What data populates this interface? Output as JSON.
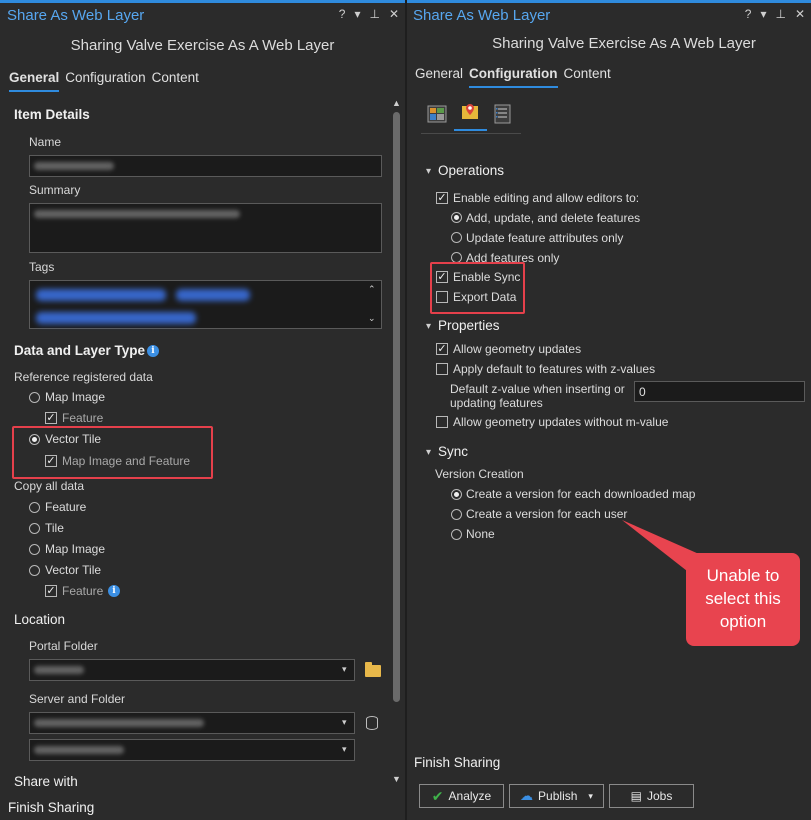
{
  "left": {
    "title": "Share As Web Layer",
    "window_controls": [
      "?",
      "▾",
      "⊥",
      "✕"
    ],
    "subtitle": "Sharing Valve Exercise As A Web Layer",
    "tabs": [
      "General",
      "Configuration",
      "Content"
    ],
    "item_details": {
      "heading": "Item Details",
      "name_label": "Name",
      "summary_label": "Summary",
      "tags_label": "Tags"
    },
    "data_layer_type": {
      "heading": "Data and Layer Type",
      "reference_label": "Reference registered data",
      "ref_options": [
        "Map Image",
        "Feature",
        "Vector Tile",
        "Map Image and Feature"
      ],
      "copy_label": "Copy all data",
      "copy_options": [
        "Feature",
        "Tile",
        "Map Image",
        "Vector Tile",
        "Feature"
      ]
    },
    "location": {
      "heading": "Location",
      "portal_folder_label": "Portal Folder",
      "server_folder_label": "Server and Folder"
    },
    "share_with": "Share with",
    "finish_sharing": "Finish Sharing"
  },
  "right": {
    "title": "Share As Web Layer",
    "window_controls": [
      "?",
      "▾",
      "⊥",
      "✕"
    ],
    "subtitle": "Sharing Valve Exercise As A Web Layer",
    "tabs": [
      "General",
      "Configuration",
      "Content"
    ],
    "operations": {
      "heading": "Operations",
      "enable_editing": "Enable editing and allow editors to:",
      "edit_options": [
        "Add, update, and delete features",
        "Update feature attributes only",
        "Add features only"
      ],
      "enable_sync": "Enable Sync",
      "export_data": "Export Data"
    },
    "properties": {
      "heading": "Properties",
      "allow_geometry": "Allow geometry updates",
      "apply_default": "Apply default to features with z-values",
      "default_z_label_1": "Default z-value when inserting or",
      "default_z_label_2": "updating features",
      "default_z_value": "0",
      "allow_without_m": "Allow geometry updates without m-value"
    },
    "sync": {
      "heading": "Sync",
      "version_creation": "Version Creation",
      "options": [
        "Create a version for each downloaded map",
        "Create a version for each user",
        "None"
      ]
    },
    "callout": [
      "Unable to",
      "select this",
      "option"
    ],
    "finish_sharing": "Finish Sharing",
    "buttons": {
      "analyze": "Analyze",
      "publish": "Publish",
      "jobs": "Jobs"
    }
  },
  "colors": {
    "accent": "#2f8bde",
    "callout": "#e8444f",
    "redbox": "#e5404b"
  }
}
